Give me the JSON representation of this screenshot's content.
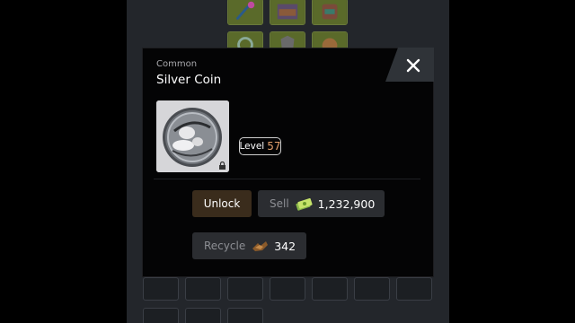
{
  "item": {
    "rarity": "Common",
    "name": "Silver Coin",
    "level_label": "Level",
    "level_value": "57",
    "lock_icon": "lock-icon"
  },
  "actions": {
    "unlock_label": "Unlock",
    "sell_label": "Sell",
    "sell_value": "1,232,900",
    "sell_icon": "cash-icon",
    "recycle_label": "Recycle",
    "recycle_value": "342",
    "recycle_icon": "scrap-icon"
  },
  "close_icon": "close-icon",
  "colors": {
    "modal_bg": "#040405",
    "level_number": "#e3a06d",
    "unlock_bg": "#3a2c1c",
    "button_bg": "#2b2d31",
    "corner_bg": "#2f3338"
  }
}
